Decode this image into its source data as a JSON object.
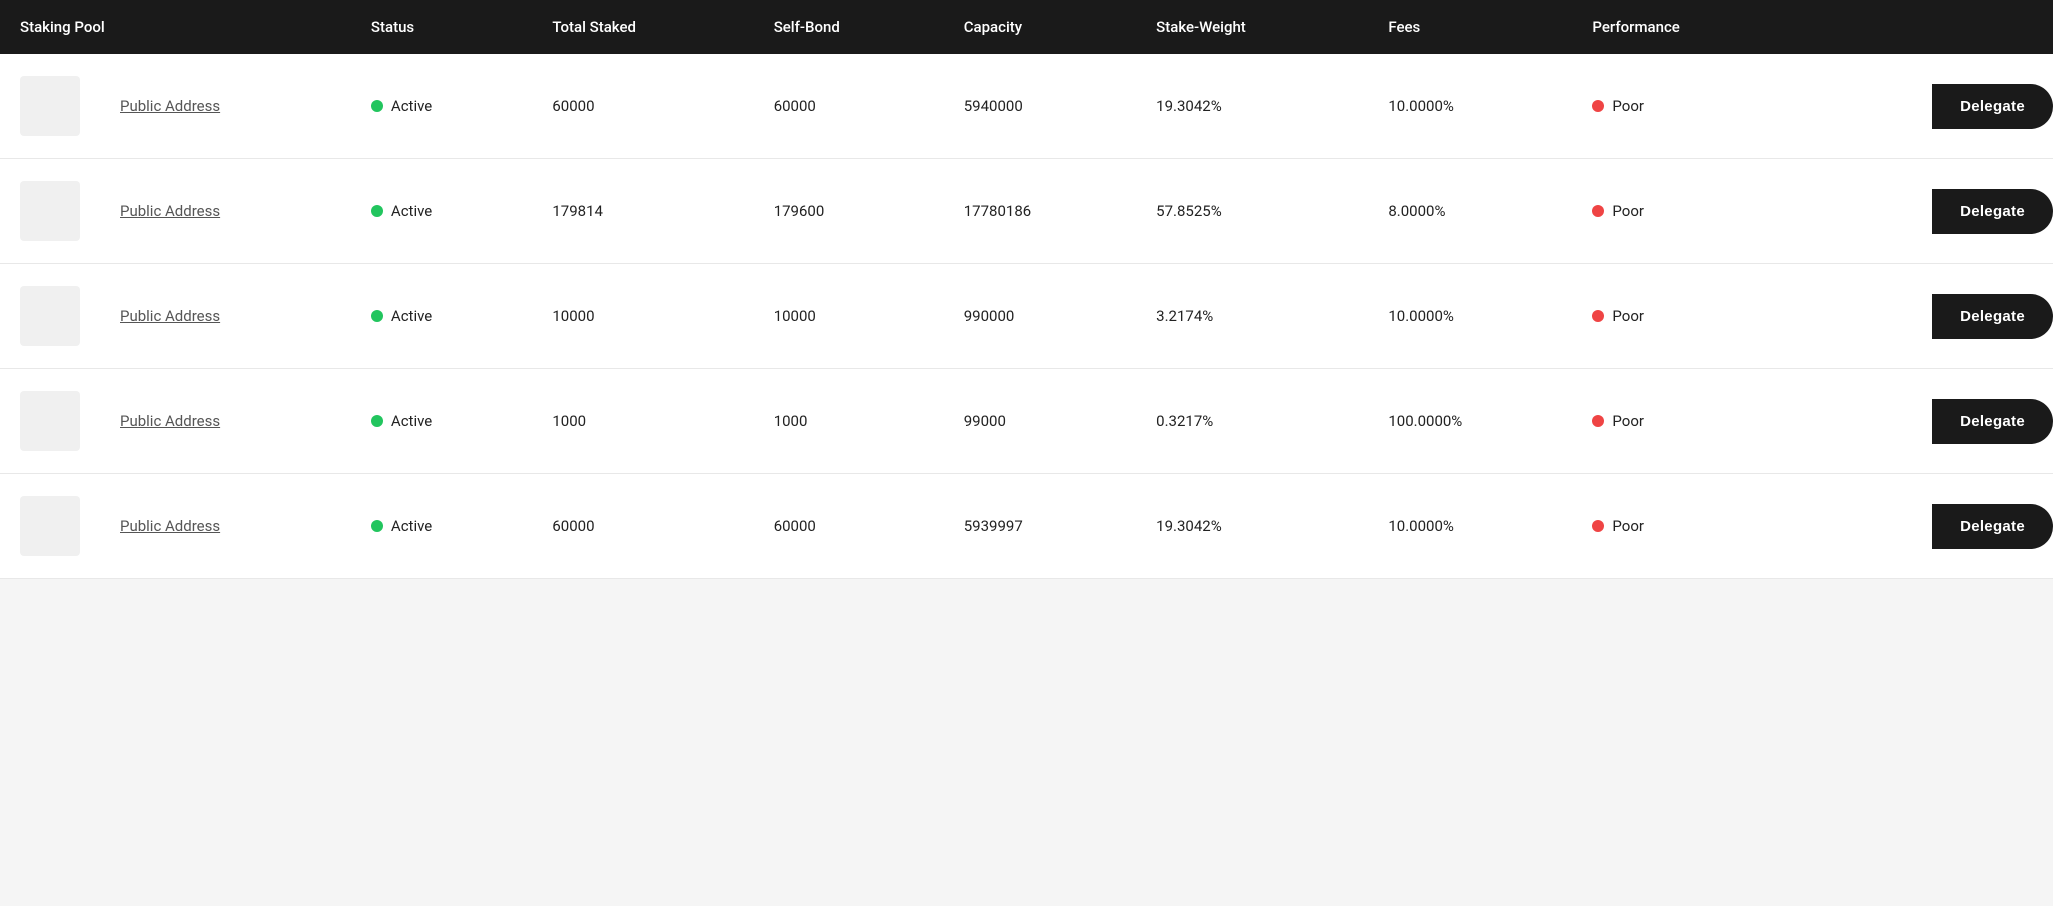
{
  "table": {
    "headers": [
      {
        "key": "staking-pool",
        "label": "Staking Pool"
      },
      {
        "key": "status",
        "label": "Status"
      },
      {
        "key": "total-staked",
        "label": "Total Staked"
      },
      {
        "key": "self-bond",
        "label": "Self-Bond"
      },
      {
        "key": "capacity",
        "label": "Capacity"
      },
      {
        "key": "stake-weight",
        "label": "Stake-Weight"
      },
      {
        "key": "fees",
        "label": "Fees"
      },
      {
        "key": "performance",
        "label": "Performance"
      },
      {
        "key": "action",
        "label": ""
      }
    ],
    "rows": [
      {
        "id": 1,
        "address": "Public Address",
        "status": "Active",
        "totalStaked": "60000",
        "selfBond": "60000",
        "capacity": "5940000",
        "stakeWeight": "19.3042%",
        "fees": "10.0000%",
        "performance": "Poor",
        "delegateLabel": "Delegate"
      },
      {
        "id": 2,
        "address": "Public Address",
        "status": "Active",
        "totalStaked": "179814",
        "selfBond": "179600",
        "capacity": "17780186",
        "stakeWeight": "57.8525%",
        "fees": "8.0000%",
        "performance": "Poor",
        "delegateLabel": "Delegate"
      },
      {
        "id": 3,
        "address": "Public Address",
        "status": "Active",
        "totalStaked": "10000",
        "selfBond": "10000",
        "capacity": "990000",
        "stakeWeight": "3.2174%",
        "fees": "10.0000%",
        "performance": "Poor",
        "delegateLabel": "Delegate"
      },
      {
        "id": 4,
        "address": "Public Address",
        "status": "Active",
        "totalStaked": "1000",
        "selfBond": "1000",
        "capacity": "99000",
        "stakeWeight": "0.3217%",
        "fees": "100.0000%",
        "performance": "Poor",
        "delegateLabel": "Delegate"
      },
      {
        "id": 5,
        "address": "Public Address",
        "status": "Active",
        "totalStaked": "60000",
        "selfBond": "60000",
        "capacity": "5939997",
        "stakeWeight": "19.3042%",
        "fees": "10.0000%",
        "performance": "Poor",
        "delegateLabel": "Delegate"
      }
    ]
  }
}
